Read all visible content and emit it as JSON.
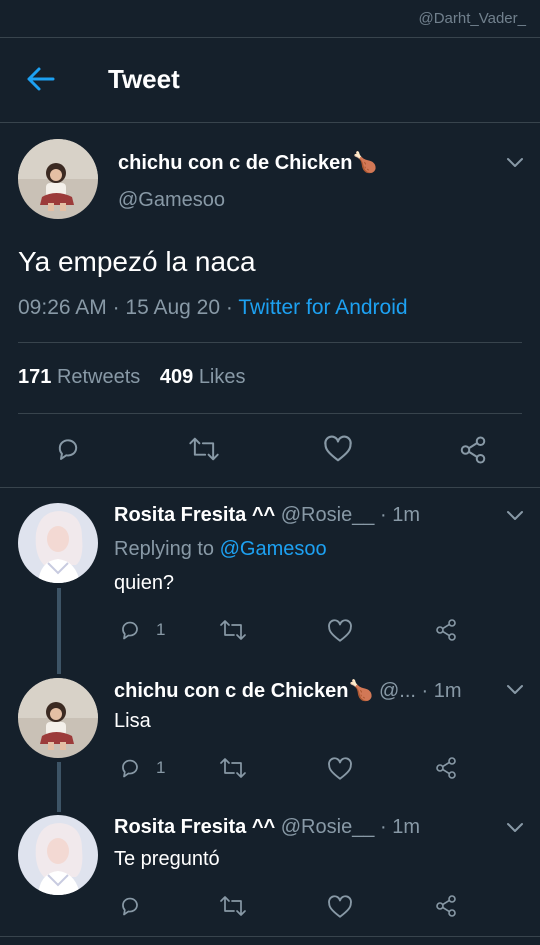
{
  "watermark": "@Darht_Vader_",
  "header": {
    "title": "Tweet"
  },
  "main_tweet": {
    "display_name": "chichu con c de Chicken",
    "emoji": "🍗",
    "handle": "@Gamesoo",
    "text": "Ya empezó la naca",
    "time": "09:26 AM",
    "sep1": "·",
    "date": "15 Aug 20",
    "sep2": "·",
    "source": "Twitter for Android",
    "retweets_count": "171",
    "retweets_label": "Retweets",
    "likes_count": "409",
    "likes_label": "Likes"
  },
  "replies": [
    {
      "display_name": "Rosita Fresita ^^",
      "handle": "@Rosie__",
      "time": "· 1m",
      "replying_prefix": "Replying to",
      "replying_handle": "@Gamesoo",
      "text": "quien?",
      "reply_count": "1"
    },
    {
      "display_name": "chichu con c de Chicken",
      "emoji": "🍗",
      "handle": "@...",
      "time": "· 1m",
      "text": "Lisa",
      "reply_count": "1"
    },
    {
      "display_name": "Rosita Fresita ^^",
      "handle": "@Rosie__",
      "time": "· 1m",
      "text": "Te preguntó",
      "reply_count": ""
    }
  ],
  "colors": {
    "background": "#15202b",
    "accent": "#1da1f2",
    "muted": "#8899a6",
    "divider": "#38444d"
  },
  "icons": [
    "back-arrow-icon",
    "chevron-down-icon",
    "reply-icon",
    "retweet-icon",
    "like-icon",
    "share-icon"
  ]
}
